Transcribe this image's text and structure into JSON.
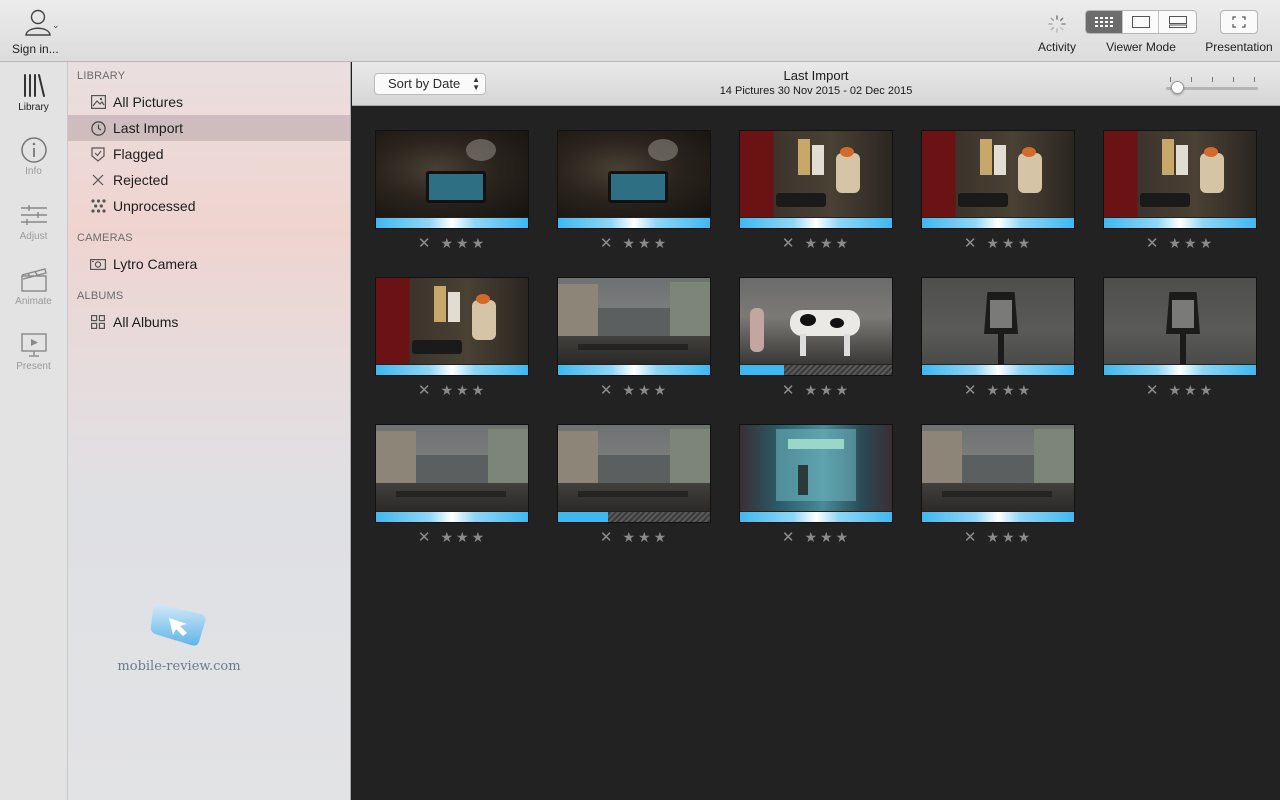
{
  "toolbar": {
    "sign_in": "Sign in...",
    "activity": "Activity",
    "viewer_mode": "Viewer Mode",
    "presentation": "Presentation"
  },
  "rail": {
    "library": "Library",
    "info": "Info",
    "adjust": "Adjust",
    "animate": "Animate",
    "present": "Present"
  },
  "sidebar": {
    "library_header": "LIBRARY",
    "cameras_header": "CAMERAS",
    "albums_header": "ALBUMS",
    "items": [
      {
        "label": "All Pictures",
        "icon": "photo-icon"
      },
      {
        "label": "Last Import",
        "icon": "clock-icon",
        "selected": true
      },
      {
        "label": "Flagged",
        "icon": "flag-icon"
      },
      {
        "label": "Rejected",
        "icon": "x-icon"
      },
      {
        "label": "Unprocessed",
        "icon": "dots-icon"
      }
    ],
    "camera": "Lytro Camera",
    "albums": "All Albums"
  },
  "watermark": "mobile-review.com",
  "content": {
    "sort_label": "Sort by Date",
    "title": "Last Import",
    "subtitle": "14 Pictures  30 Nov 2015 - 02 Dec 2015"
  },
  "colors": {
    "accent": "#3fb8ef",
    "selection": "#c4aab8"
  },
  "photos": [
    {
      "scene": "phone",
      "progress": 1.0
    },
    {
      "scene": "phone",
      "progress": 1.0
    },
    {
      "scene": "cafe",
      "progress": 1.0
    },
    {
      "scene": "cafe",
      "progress": 1.0
    },
    {
      "scene": "cafe",
      "progress": 1.0
    },
    {
      "scene": "cafe",
      "progress": 1.0
    },
    {
      "scene": "street",
      "progress": 1.0
    },
    {
      "scene": "cow",
      "progress": 0.29
    },
    {
      "scene": "lamp",
      "progress": 1.0
    },
    {
      "scene": "lamp",
      "progress": 1.0
    },
    {
      "scene": "street",
      "progress": 1.0
    },
    {
      "scene": "street",
      "progress": 0.33
    },
    {
      "scene": "shop",
      "progress": 1.0
    },
    {
      "scene": "street",
      "progress": 1.0
    }
  ],
  "rating_symbols": {
    "reject": "✕",
    "star": "★"
  }
}
